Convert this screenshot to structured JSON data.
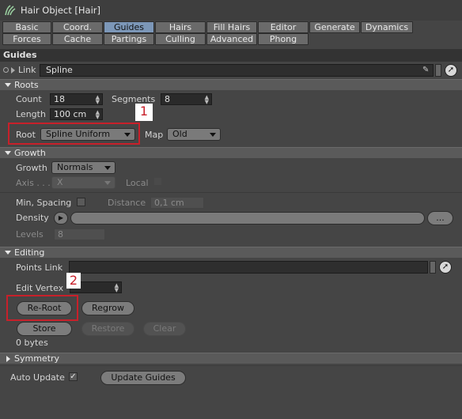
{
  "window": {
    "title": "Hair Object [Hair]"
  },
  "tabs": [
    "Basic",
    "Coord.",
    "Guides",
    "Hairs",
    "Fill Hairs",
    "Editor",
    "Generate",
    "Dynamics",
    "Forces",
    "Cache",
    "Partings",
    "Culling",
    "Advanced",
    "Phong"
  ],
  "active_tab": "Guides",
  "section_header": "Guides",
  "link": {
    "label": "Link",
    "value": "Spline"
  },
  "roots": {
    "title": "Roots",
    "count_label": "Count",
    "count_value": "18",
    "segments_label": "Segments",
    "segments_value": "8",
    "length_label": "Length",
    "length_value": "100 cm",
    "root_label": "Root",
    "root_value": "Spline Uniform",
    "map_label": "Map",
    "map_value": "Old"
  },
  "growth": {
    "title": "Growth",
    "growth_label": "Growth",
    "growth_value": "Normals",
    "axis_label": "Axis . . .",
    "axis_value": "X",
    "local_label": "Local",
    "min_spacing_label": "Min, Spacing",
    "distance_label": "Distance",
    "distance_value": "0,1 cm",
    "density_label": "Density",
    "density_more": "...",
    "levels_label": "Levels",
    "levels_value": "8"
  },
  "editing": {
    "title": "Editing",
    "points_link_label": "Points Link",
    "edit_vertex_label": "Edit Vertex",
    "reroot_label": "Re-Root",
    "regrow_label": "Regrow",
    "store_label": "Store",
    "restore_label": "Restore",
    "clear_label": "Clear",
    "bytes_text": "0 bytes"
  },
  "symmetry": {
    "title": "Symmetry"
  },
  "bottom": {
    "auto_update_label": "Auto Update",
    "auto_update_check": "✓",
    "update_guides_label": "Update Guides"
  },
  "annotations": {
    "one": "1",
    "two": "2"
  }
}
